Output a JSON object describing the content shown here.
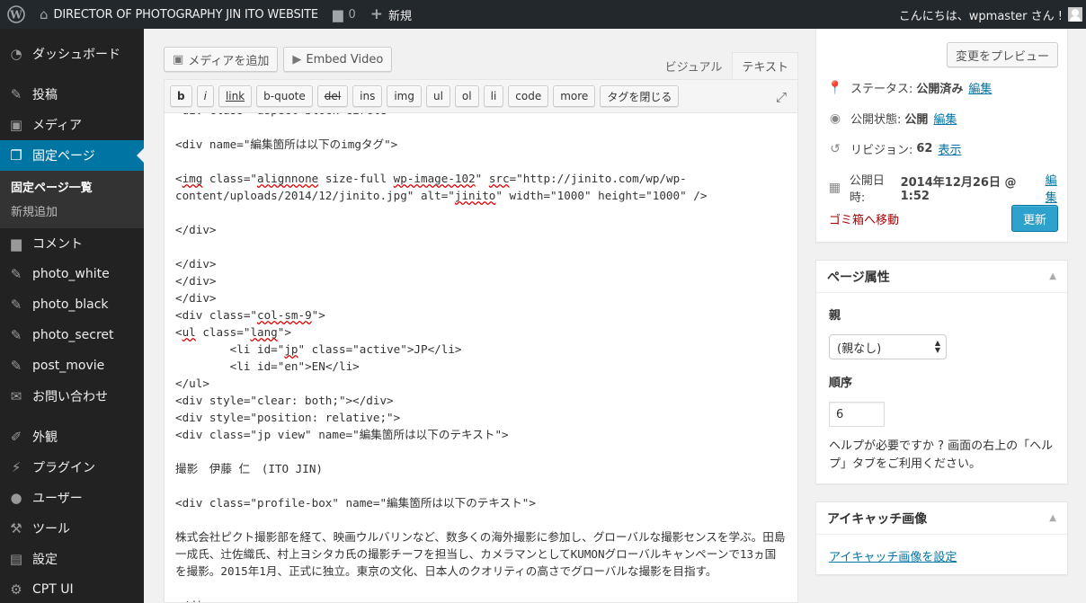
{
  "adminbar": {
    "site_name": "DIRECTOR OF PHOTOGRAPHY JIN ITO WEBSITE",
    "comments_count": "0",
    "new_label": "新規",
    "greeting": "こんにちは、wpmaster さん !"
  },
  "sidebar": {
    "dashboard": "ダッシュボード",
    "posts": "投稿",
    "media": "メディア",
    "pages": "固定ページ",
    "pages_sub": [
      "固定ページ一覧",
      "新規追加"
    ],
    "comments": "コメント",
    "photo_white": "photo_white",
    "photo_black": "photo_black",
    "photo_secret": "photo_secret",
    "post_movie": "post_movie",
    "contact": "お問い合わせ",
    "appearance": "外観",
    "plugins": "プラグイン",
    "users": "ユーザー",
    "tools": "ツール",
    "settings": "設定",
    "cpt_ui": "CPT UI"
  },
  "editor": {
    "add_media": "メディアを追加",
    "embed_video": "Embed Video",
    "tab_visual": "ビジュアル",
    "tab_text": "テキスト",
    "quicktags": [
      "b",
      "i",
      "link",
      "b-quote",
      "del",
      "ins",
      "img",
      "ul",
      "ol",
      "li",
      "code",
      "more",
      "タグを閉じる"
    ]
  },
  "publish": {
    "preview_button": "変更をプレビュー",
    "status_label": "ステータス:",
    "status_value": "公開済み",
    "visibility_label": "公開状態:",
    "visibility_value": "公開",
    "revisions_label": "リビジョン:",
    "revisions_value": "62",
    "revisions_link": "表示",
    "date_label": "公開日時:",
    "date_value": "2014年12月26日 @ 1:52",
    "edit_link": "編集",
    "trash_link": "ゴミ箱へ移動",
    "update_button": "更新"
  },
  "page_attributes": {
    "title": "ページ属性",
    "parent_label": "親",
    "parent_value": "(親なし)",
    "order_label": "順序",
    "order_value": "6",
    "help": "ヘルプが必要ですか ? 画面の右上の「ヘルプ」タブをご利用ください。"
  },
  "featured_image": {
    "title": "アイキャッチ画像",
    "set_link": "アイキャッチ画像を設定"
  }
}
